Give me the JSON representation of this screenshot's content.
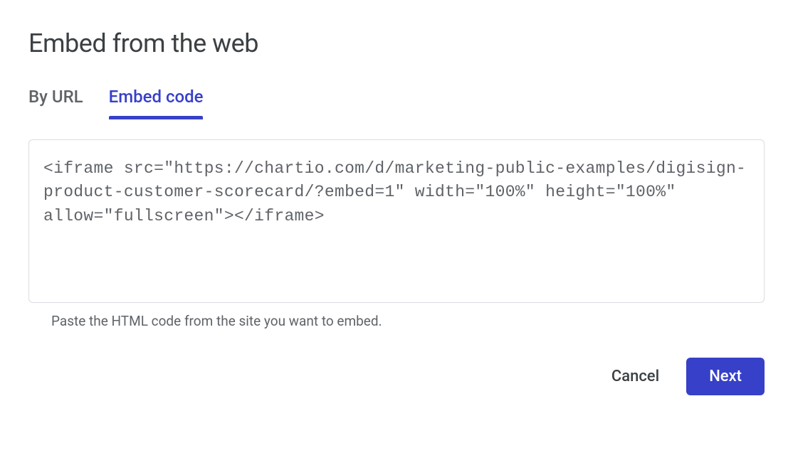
{
  "dialog": {
    "title": "Embed from the web"
  },
  "tabs": {
    "by_url": "By URL",
    "embed_code": "Embed code"
  },
  "textarea": {
    "value": "<iframe src=\"https://chartio.com/d/marketing-public-examples/digisign-product-customer-scorecard/?embed=1\" width=\"100%\" height=\"100%\" allow=\"fullscreen\"></iframe>"
  },
  "helper_text": "Paste the HTML code from the site you want to embed.",
  "buttons": {
    "cancel": "Cancel",
    "next": "Next"
  }
}
